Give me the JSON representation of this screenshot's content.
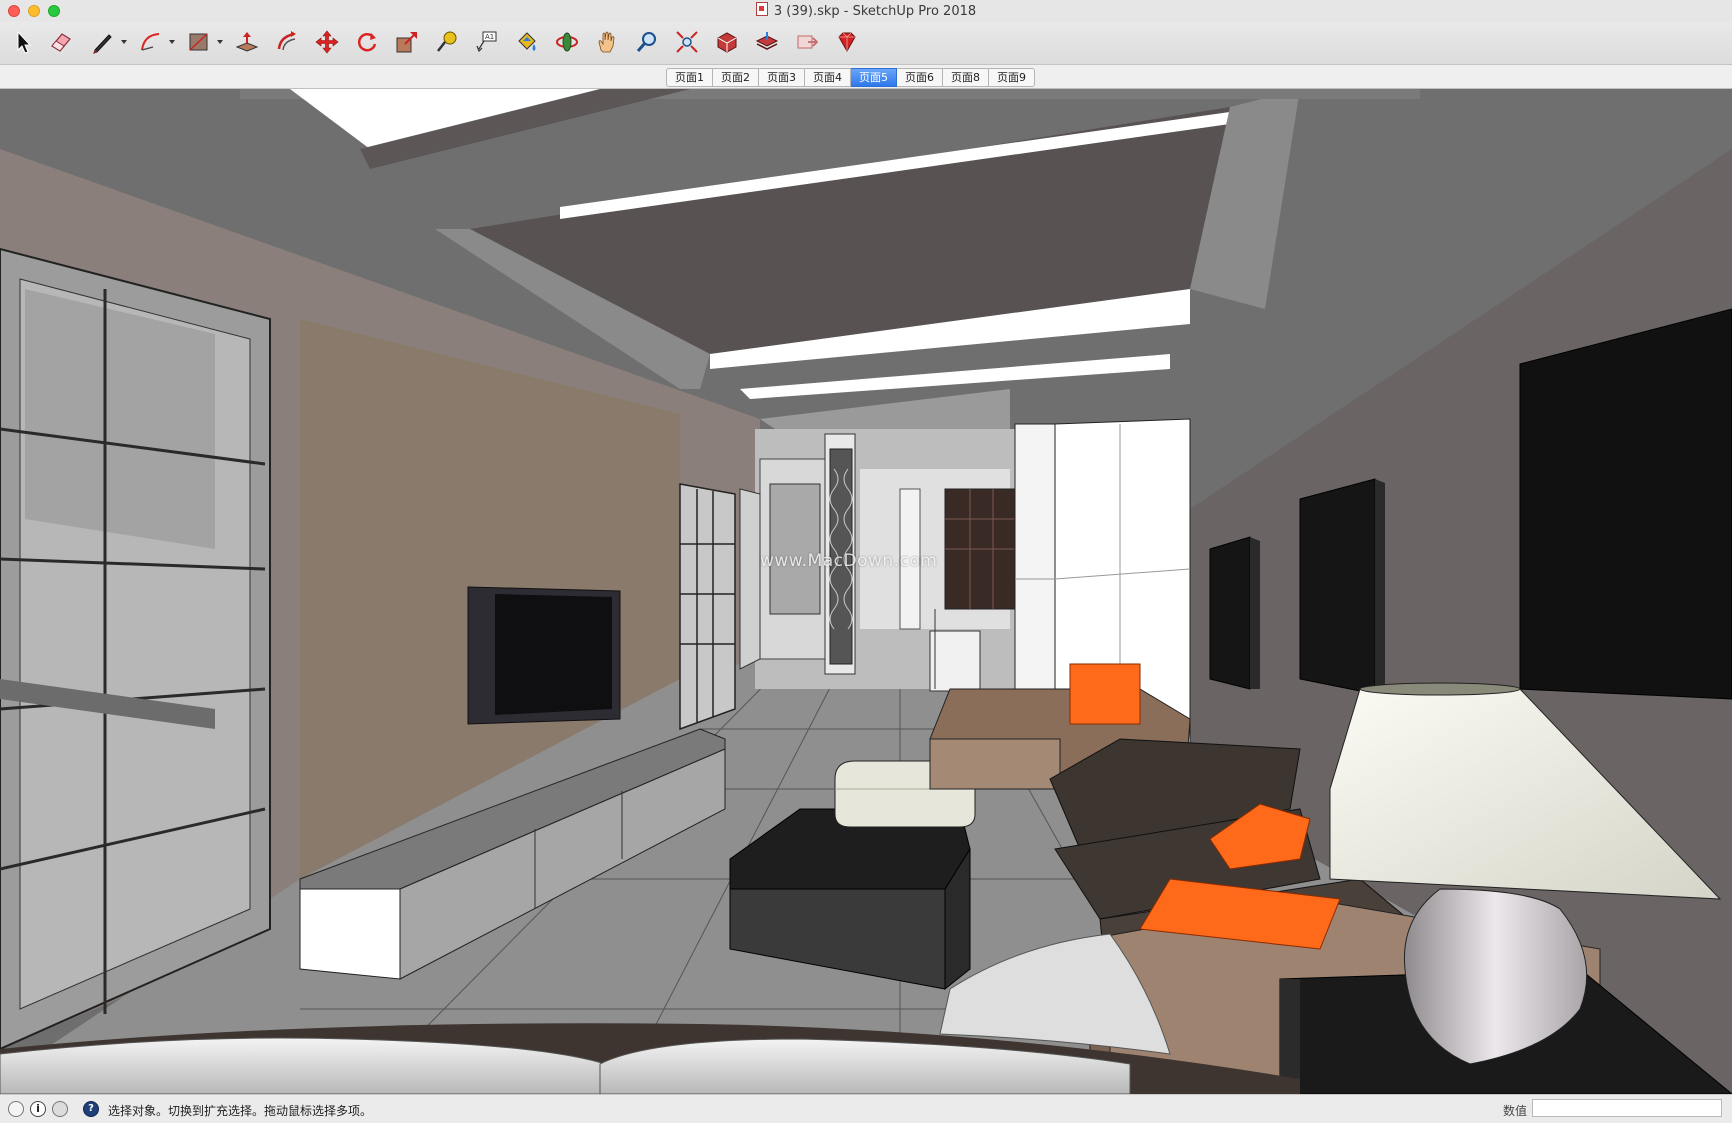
{
  "window": {
    "title": "3 (39).skp - SketchUp Pro 2018"
  },
  "toolbar": {
    "tools": [
      {
        "name": "select-tool",
        "icon": "arrow-pointer-icon"
      },
      {
        "name": "eraser-tool",
        "icon": "eraser-icon"
      },
      {
        "name": "pencil-tool",
        "icon": "pencil-icon",
        "dropdown": true
      },
      {
        "name": "arc-tool",
        "icon": "arc-icon",
        "dropdown": true
      },
      {
        "name": "rectangle-tool",
        "icon": "rectangle-icon",
        "dropdown": true
      },
      {
        "name": "push-pull-tool",
        "icon": "push-pull-icon"
      },
      {
        "name": "offset-tool",
        "icon": "offset-icon"
      },
      {
        "name": "move-tool",
        "icon": "move-arrows-icon"
      },
      {
        "name": "rotate-tool",
        "icon": "rotate-icon"
      },
      {
        "name": "scale-tool",
        "icon": "scale-icon"
      },
      {
        "name": "tape-measure-tool",
        "icon": "tape-measure-icon"
      },
      {
        "name": "text-tool",
        "icon": "text-label-icon"
      },
      {
        "name": "paint-bucket-tool",
        "icon": "paint-bucket-icon"
      },
      {
        "name": "orbit-tool",
        "icon": "orbit-icon"
      },
      {
        "name": "pan-tool",
        "icon": "hand-icon"
      },
      {
        "name": "zoom-tool",
        "icon": "magnifier-icon"
      },
      {
        "name": "zoom-extents-tool",
        "icon": "zoom-extents-icon"
      },
      {
        "name": "warehouse-tool",
        "icon": "3d-warehouse-icon"
      },
      {
        "name": "share-model-tool",
        "icon": "share-model-icon"
      },
      {
        "name": "extension-warehouse-tool",
        "icon": "extension-icon"
      },
      {
        "name": "ruby-console-tool",
        "icon": "ruby-gem-icon"
      }
    ]
  },
  "tabs": [
    {
      "label": "页面1",
      "active": false
    },
    {
      "label": "页面2",
      "active": false
    },
    {
      "label": "页面3",
      "active": false
    },
    {
      "label": "页面4",
      "active": false
    },
    {
      "label": "页面5",
      "active": true
    },
    {
      "label": "页面6",
      "active": false
    },
    {
      "label": "页面8",
      "active": false
    },
    {
      "label": "页面9",
      "active": false
    }
  ],
  "viewport": {
    "watermark": "www.MacDown.com"
  },
  "statusbar": {
    "info_glyph": "i",
    "help_glyph": "?",
    "message": "选择对象。切换到扩充选择。拖动鼠标选择多项。",
    "measurements_label": "数值",
    "measurements_value": ""
  },
  "colors": {
    "active_tab": "#2f78ec",
    "accent_orange": "#ff6a1a",
    "close": "#ff5f57",
    "minimize": "#ffbd2e",
    "zoom": "#28c940"
  }
}
